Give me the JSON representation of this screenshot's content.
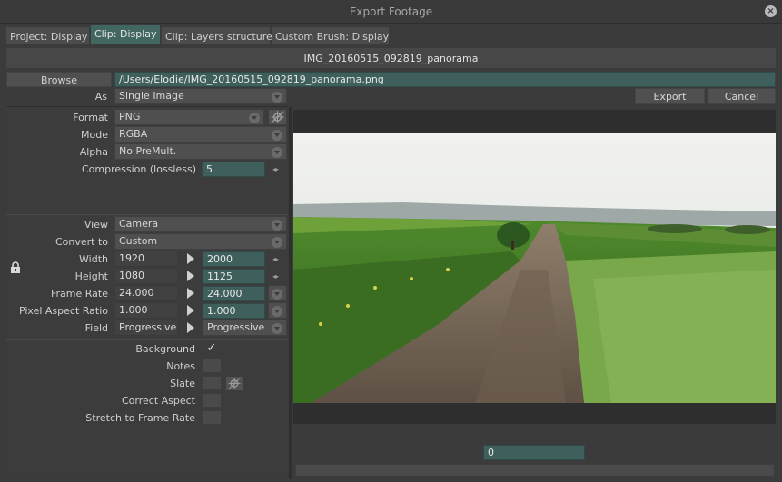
{
  "window": {
    "title": "Export Footage"
  },
  "tabs": [
    {
      "label": "Project: Display"
    },
    {
      "label": "Clip: Display"
    },
    {
      "label": "Clip: Layers structure"
    },
    {
      "label": "Custom Brush: Display"
    }
  ],
  "header": {
    "filename": "IMG_20160515_092819_panorama"
  },
  "browse": {
    "label": "Browse",
    "path": "/Users/Elodie/IMG_20160515_092819_panorama.png"
  },
  "as": {
    "label": "As",
    "value": "Single Image"
  },
  "buttons": {
    "export": "Export",
    "cancel": "Cancel"
  },
  "format": {
    "label": "Format",
    "value": "PNG"
  },
  "mode": {
    "label": "Mode",
    "value": "RGBA"
  },
  "alpha": {
    "label": "Alpha",
    "value": "No PreMult."
  },
  "compression": {
    "label": "Compression (lossless)",
    "value": "5"
  },
  "view": {
    "label": "View",
    "value": "Camera"
  },
  "convert": {
    "label": "Convert to",
    "value": "Custom"
  },
  "width": {
    "label": "Width",
    "src": "1920",
    "dst": "2000"
  },
  "height": {
    "label": "Height",
    "src": "1080",
    "dst": "1125"
  },
  "framerate": {
    "label": "Frame Rate",
    "src": "24.000",
    "dst": "24.000"
  },
  "par": {
    "label": "Pixel Aspect Ratio",
    "src": "1.000",
    "dst": "1.000"
  },
  "field": {
    "label": "Field",
    "src": "Progressive",
    "dst": "Progressive"
  },
  "options": {
    "background": {
      "label": "Background",
      "checked": true
    },
    "notes": {
      "label": "Notes",
      "checked": false
    },
    "slate": {
      "label": "Slate",
      "checked": false
    },
    "correct_aspect": {
      "label": "Correct Aspect",
      "checked": false
    },
    "stretch": {
      "label": "Stretch to Frame Rate",
      "checked": false
    }
  },
  "timeline": {
    "frame": "0"
  },
  "icons": {
    "lock": "lock-icon",
    "settings": "settings-icon",
    "close": "close-icon",
    "check": "check-icon"
  }
}
